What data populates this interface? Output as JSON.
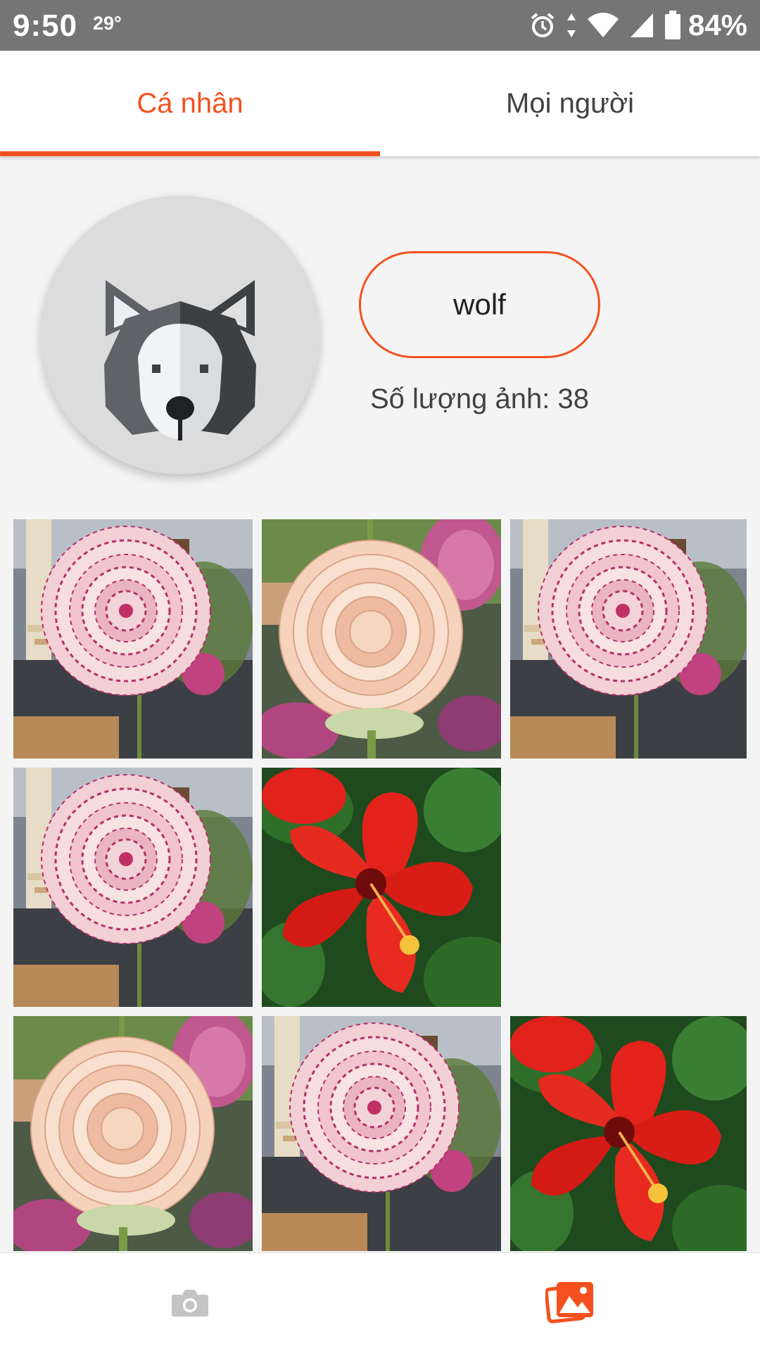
{
  "status_bar": {
    "time": "9:50",
    "temperature": "29°",
    "battery": "84%",
    "icons": [
      "alarm-icon",
      "data-arrows-icon",
      "wifi-icon",
      "signal-icon",
      "battery-icon"
    ]
  },
  "tabs": [
    {
      "label": "Cá nhân",
      "active": true
    },
    {
      "label": "Mọi người",
      "active": false
    }
  ],
  "profile": {
    "avatar_icon": "husky-wolf-icon",
    "name": "wolf",
    "photo_count_text": "Số lượng ảnh: 38"
  },
  "photos": [
    {
      "subject": "pink-rose-cafe",
      "slot": 0
    },
    {
      "subject": "peach-rose",
      "slot": 1
    },
    {
      "subject": "pink-rose-cafe",
      "slot": 2
    },
    {
      "subject": "pink-rose-cafe",
      "slot": 3
    },
    {
      "subject": "red-hibiscus",
      "slot": 4
    },
    {
      "subject": "peach-rose",
      "slot": 6
    },
    {
      "subject": "pink-rose-cafe",
      "slot": 7
    },
    {
      "subject": "red-hibiscus",
      "slot": 8
    }
  ],
  "bottom_nav": [
    {
      "icon": "camera-icon",
      "active": false
    },
    {
      "icon": "gallery-icon",
      "active": true
    }
  ],
  "colors": {
    "accent": "#f4511e",
    "status_bar": "#757575",
    "background": "#f4f4f4",
    "inactive_icon": "#c4c4c4"
  }
}
